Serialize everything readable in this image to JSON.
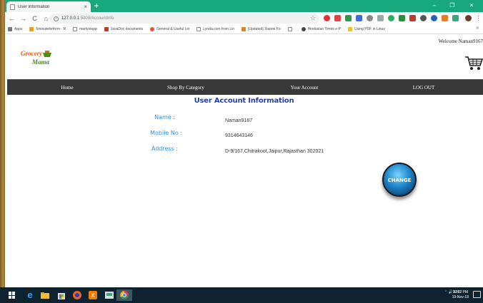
{
  "browser": {
    "tab_title": "User Information",
    "tab_close": "×",
    "new_tab": "+",
    "win_controls": {
      "minimize": "–",
      "maximize": "❐",
      "close": "✕"
    },
    "url_host": "127.0.0.1",
    "url_rest": ":5000/AccountInfo",
    "nav": {
      "back": "←",
      "forward": "→",
      "reload": "C",
      "home": "⌂"
    },
    "star": "☆",
    "bookmarks": [
      "Apps",
      "5minuteforform - R",
      "martystepp",
      "JavaDoc documents",
      "General & Useful Lin",
      "Lynda.com from Lin",
      "[Updated] Xiaomi Fo",
      "",
      "Hindustan Times e-P",
      "Using PDF in Linux"
    ],
    "bookmark_more": "»"
  },
  "site": {
    "welcome": "Welcome Naman9167",
    "logo_top": "Grocery",
    "logo_bottom": "Mama",
    "nav": [
      "Home",
      "Shop By Category",
      "Your Account",
      "LOG OUT"
    ],
    "heading": "User Account Information",
    "fields": [
      {
        "label": "Name :",
        "value": "Naman9167"
      },
      {
        "label": "Mobile No :",
        "value": "9314643146"
      },
      {
        "label": "Address :",
        "value": "D-9/167,Chitrakoot,Jaipur,Rajasthan 302021"
      }
    ],
    "change_button": "CHANGE"
  },
  "taskbar": {
    "tray": "⌃ 🔊 ENG",
    "time": "10:37 PM",
    "date": "19-Nov-18"
  },
  "colors": {
    "tab_strip": "#17a97d",
    "navbar": "#383838",
    "heading": "#1d3fb8",
    "label": "#2a8fe0",
    "taskbar": "#0f2230"
  }
}
